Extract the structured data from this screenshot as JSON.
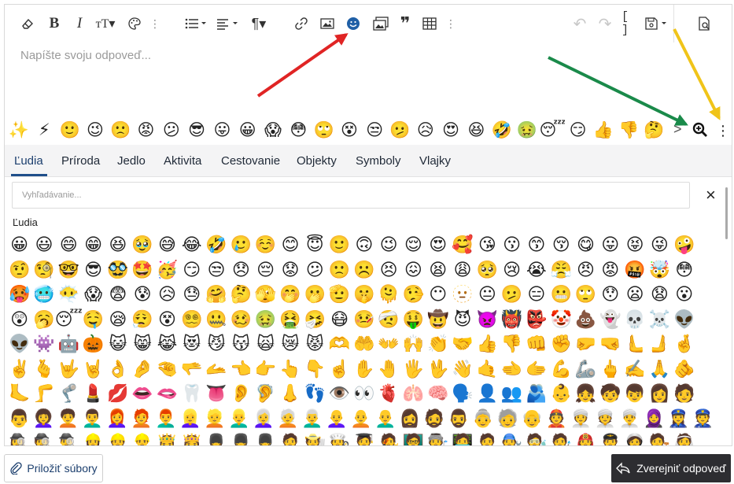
{
  "editor": {
    "placeholder": "Napíšte svoju odpoveď..."
  },
  "toolbar": {
    "items": [
      {
        "name": "eraser-icon",
        "glyph": "⌫"
      },
      {
        "name": "bold-button",
        "glyph": "B"
      },
      {
        "name": "italic-button",
        "glyph": "I"
      },
      {
        "name": "text-size-button",
        "glyph": "тT▾"
      },
      {
        "name": "palette-icon",
        "glyph": "🎨"
      },
      {
        "name": "more-icon",
        "glyph": "⋮"
      },
      {
        "name": "list-button",
        "glyph": "☰▾"
      },
      {
        "name": "align-button",
        "glyph": "≡▾"
      },
      {
        "name": "paragraph-button",
        "glyph": "¶▾"
      },
      {
        "name": "link-icon",
        "glyph": "🔗"
      },
      {
        "name": "image-icon",
        "glyph": "🖼"
      },
      {
        "name": "emoji-button",
        "glyph": "☻"
      },
      {
        "name": "media-icon",
        "glyph": "▣"
      },
      {
        "name": "quote-icon",
        "glyph": "❞"
      },
      {
        "name": "table-icon",
        "glyph": "▦"
      },
      {
        "name": "more-icon",
        "glyph": "⋮"
      },
      {
        "name": "undo-icon",
        "glyph": "↶"
      },
      {
        "name": "redo-icon",
        "glyph": "↷"
      },
      {
        "name": "bbcode-icon",
        "glyph": "[ ]"
      },
      {
        "name": "save-drafts-button",
        "glyph": "💾▾"
      },
      {
        "name": "preview-icon",
        "glyph": "🔍"
      }
    ]
  },
  "quickbar": {
    "emojis": [
      "✨",
      "⚡",
      "🙂",
      "😉",
      "🙁",
      "😡",
      "😕",
      "😎",
      "😛",
      "😀",
      "😱",
      "😳",
      "🙄",
      "😵",
      "😒",
      "🫤",
      "😥",
      "😍",
      "😆",
      "🤣",
      "🤢",
      "😴",
      "😏",
      "👍",
      "👎",
      "🤔"
    ],
    "next": ">"
  },
  "tabs": {
    "items": [
      "Ľudia",
      "Príroda",
      "Jedlo",
      "Aktivita",
      "Cestovanie",
      "Objekty",
      "Symboly",
      "Vlajky"
    ],
    "active": "Ľudia"
  },
  "search": {
    "placeholder": "Vyhľadávanie...",
    "close": "×"
  },
  "category": {
    "label": "Ľudia"
  },
  "emoji_grid": [
    [
      "😀",
      "😃",
      "😄",
      "😁",
      "😆",
      "🥹",
      "😅",
      "😂",
      "🤣",
      "🥲",
      "☺️",
      "😊",
      "😇",
      "🙂",
      "🙃",
      "😉",
      "😌",
      "😍",
      "🥰",
      "😘",
      "😗",
      "😙",
      "😚",
      "😋",
      "😛",
      "😝",
      "😜",
      "🤪"
    ],
    [
      "🤨",
      "🧐",
      "🤓",
      "😎",
      "🥸",
      "🤩",
      "🥳",
      "😏",
      "😒",
      "😞",
      "😔",
      "😟",
      "😕",
      "🙁",
      "☹️",
      "😣",
      "😖",
      "😫",
      "😩",
      "🥺",
      "😢",
      "😭",
      "😤",
      "😠",
      "😡",
      "🤬",
      "🤯",
      "😳"
    ],
    [
      "🥵",
      "🥶",
      "😶‍🌫️",
      "😱",
      "😨",
      "😰",
      "😥",
      "😓",
      "🤗",
      "🤔",
      "🫣",
      "🤭",
      "🫢",
      "🫡",
      "🤫",
      "🫠",
      "🤥",
      "😶",
      "🫥",
      "😐",
      "🫤",
      "😑",
      "😬",
      "🙄",
      "😯",
      "😦",
      "😧",
      "😮"
    ],
    [
      "😲",
      "🥱",
      "😴",
      "🤤",
      "😪",
      "😮‍💨",
      "😵",
      "😵‍💫",
      "🤐",
      "🥴",
      "🤢",
      "🤮",
      "🤧",
      "😷",
      "🤒",
      "🤕",
      "🤑",
      "🤠",
      "😈",
      "👿",
      "👹",
      "👺",
      "🤡",
      "💩",
      "👻",
      "💀",
      "☠️",
      "👽"
    ],
    [
      "👽",
      "👾",
      "🤖",
      "🎃",
      "😺",
      "😸",
      "😹",
      "😻",
      "😼",
      "😽",
      "🙀",
      "😿",
      "😾",
      "🫶",
      "🤲",
      "👐",
      "🙌",
      "👏",
      "🤝",
      "👍",
      "👎",
      "👊",
      "✊",
      "🤛",
      "🤜",
      "🫷",
      "🫸",
      "🤞"
    ],
    [
      "✌️",
      "🫰",
      "🤟",
      "🤘",
      "👌",
      "🤌",
      "🤏",
      "🫳",
      "🫴",
      "👈",
      "👉",
      "👆",
      "👇",
      "☝️",
      "✋",
      "🤚",
      "🖐️",
      "🖖",
      "👋",
      "🤙",
      "🫲",
      "🫱",
      "💪",
      "🦾",
      "🖕",
      "✍️",
      "🙏",
      "🫵"
    ],
    [
      "🦶",
      "🦵",
      "🦿",
      "💄",
      "💋",
      "👄",
      "🫦",
      "🦷",
      "👅",
      "👂",
      "🦻",
      "👃",
      "👣",
      "👁️",
      "👀",
      "🫀",
      "🫁",
      "🧠",
      "🗣️",
      "👤",
      "👥",
      "🫂",
      "👶",
      "👧",
      "🧒",
      "👦",
      "👩",
      "🧑"
    ],
    [
      "👨",
      "👩‍🦱",
      "🧑‍🦱",
      "👨‍🦱",
      "👩‍🦰",
      "🧑‍🦰",
      "👨‍🦰",
      "👱‍♀️",
      "👱",
      "👱‍♂️",
      "👩‍🦳",
      "🧑‍🦳",
      "👨‍🦳",
      "👩‍🦲",
      "🧑‍🦲",
      "👨‍🦲",
      "🧔‍♀️",
      "🧔",
      "🧔‍♂️",
      "👵",
      "🧓",
      "👴",
      "👲",
      "👳‍♀️",
      "👳",
      "👳‍♂️",
      "🧕",
      "👮‍♀️",
      "👮"
    ],
    [
      "🕵️‍♀️",
      "🕵️",
      "🕵️‍♂️",
      "👷‍♀️",
      "👷",
      "👷‍♂️",
      "🤴",
      "👸",
      "💂‍♀️",
      "💂",
      "💂‍♂️",
      "🧑‍⚕️",
      "🧑‍🌾",
      "🧑‍🍳",
      "🧑‍🎓",
      "🧑‍🎤",
      "🧑‍🏫",
      "🧑‍🏭",
      "🧑‍💻",
      "🧑‍💼",
      "🧑‍🔧",
      "🧑‍🔬",
      "🧑‍🎨",
      "🧑‍🚒",
      "🧑‍✈️",
      "🧑‍🚀",
      "🧑‍⚖️",
      "👰"
    ]
  ],
  "footer": {
    "attach_label": "Priložiť súbory",
    "post_label": "Zverejniť odpoveď"
  },
  "annotation_colors": {
    "red": "#e02424",
    "green": "#1a8a4a",
    "yellow": "#f0c419"
  }
}
